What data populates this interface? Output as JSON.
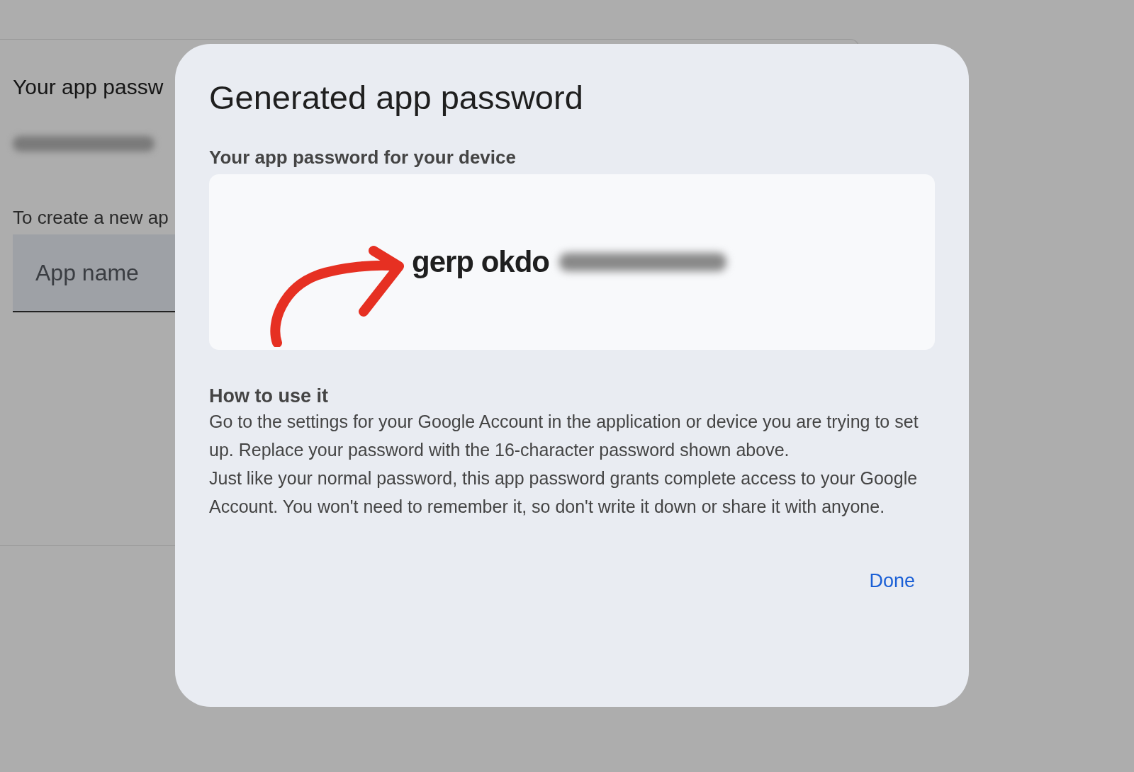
{
  "background_page": {
    "heading": "Your app passw",
    "instruction": "To create a new ap",
    "app_name_field": {
      "placeholder": "App name"
    }
  },
  "dialog": {
    "title": "Generated app password",
    "subtitle": "Your app password for your device",
    "password": "gerp okdo",
    "help_heading": "How to use it",
    "help_paragraphs": [
      "Go to the settings for your Google Account in the application or device you are trying to set up. Replace your password with the 16-character password shown above.",
      "Just like your normal password, this app password grants complete access to your Google Account. You won't need to remember it, so don't write it down or share it with anyone."
    ],
    "done_button": "Done"
  }
}
